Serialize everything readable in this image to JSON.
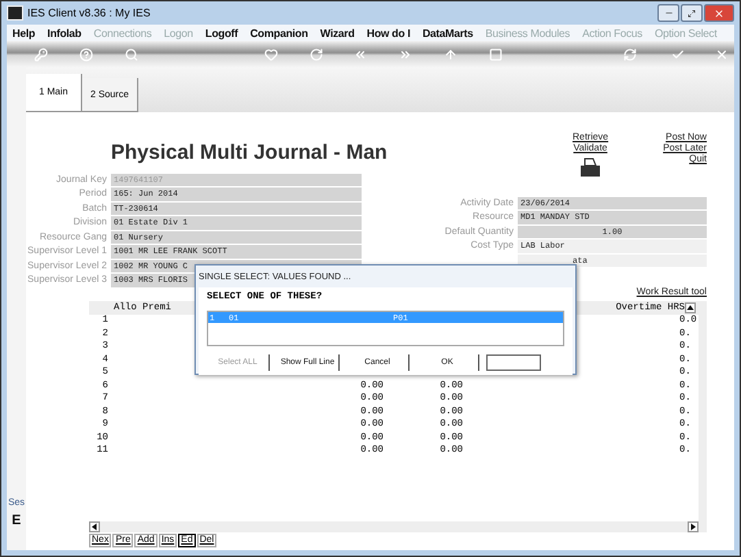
{
  "window": {
    "title": "IES Client v8.36 : My IES"
  },
  "menu": [
    {
      "label": "Help",
      "disabled": false
    },
    {
      "label": "Infolab",
      "disabled": false
    },
    {
      "label": "Connections",
      "disabled": true
    },
    {
      "label": "Logon",
      "disabled": true
    },
    {
      "label": "Logoff",
      "disabled": false
    },
    {
      "label": "Companion",
      "disabled": false
    },
    {
      "label": "Wizard",
      "disabled": false
    },
    {
      "label": "How do I",
      "disabled": false
    },
    {
      "label": "DataMarts",
      "disabled": false
    },
    {
      "label": "Business Modules",
      "disabled": true
    },
    {
      "label": "Action Focus",
      "disabled": true
    },
    {
      "label": "Option Select",
      "disabled": true
    }
  ],
  "tabs": [
    {
      "label": "1 Main",
      "selected": true
    },
    {
      "label": "2 Source",
      "selected": false
    }
  ],
  "form": {
    "title": "Physical Multi Journal - Man",
    "left_fields": [
      {
        "label": "Journal Key",
        "value": "1497641107",
        "disabled": true
      },
      {
        "label": "Period",
        "value": "165: Jun 2014",
        "disabled": false
      },
      {
        "label": "Batch",
        "value": "TT-230614",
        "disabled": false
      },
      {
        "label": "Division",
        "value": "01 Estate Div 1",
        "disabled": false
      },
      {
        "label": "Resource Gang",
        "value": "01 Nursery",
        "disabled": false
      },
      {
        "label": "Supervisor Level 1",
        "value": "1001 MR LEE FRANK SCOTT",
        "disabled": false
      },
      {
        "label": "Supervisor Level 2",
        "value": "1002 MR YOUNG C",
        "disabled": false
      },
      {
        "label": "Supervisor Level 3",
        "value": "1003 MRS FLORIS",
        "disabled": false
      }
    ],
    "links_left": [
      "Retrieve",
      "Validate"
    ],
    "links_right": [
      "Post Now",
      "Post Later",
      "Quit"
    ],
    "right_fields": [
      {
        "label": "Activity Date",
        "value": "23/06/2014",
        "kind": "text"
      },
      {
        "label": "Resource",
        "value": "MD1 MANDAY STD",
        "kind": "text"
      },
      {
        "label": "Default Quantity",
        "value": "1.00",
        "kind": "number"
      },
      {
        "label": "Cost Type",
        "value": "LAB Labor",
        "kind": "text"
      }
    ],
    "covered_field_value": "ata",
    "work_result_link": "Work Result tool"
  },
  "grid": {
    "columns": [
      "Allo Premi",
      "Overtime HRS"
    ],
    "rows": [
      {
        "number": "1",
        "overtime": "0.0"
      },
      {
        "number": "2",
        "overtime": "0."
      },
      {
        "number": "3",
        "overtime": "0."
      },
      {
        "number": "4",
        "overtime": "0."
      },
      {
        "number": "5",
        "overtime": "0."
      },
      {
        "number": "6",
        "col_2": "0.00",
        "col_3": "0.00",
        "overtime": "0."
      },
      {
        "number": "7",
        "col_2": "0.00",
        "col_3": "0.00",
        "overtime": "0."
      },
      {
        "number": "8",
        "col_2": "0.00",
        "col_3": "0.00",
        "overtime": "0."
      },
      {
        "number": "9",
        "col_2": "0.00",
        "col_3": "0.00",
        "overtime": "0."
      },
      {
        "number": "10",
        "col_2": "0.00",
        "col_3": "0.00",
        "overtime": "0."
      },
      {
        "number": "11",
        "col_2": "0.00",
        "col_3": "0.00",
        "overtime": "0."
      }
    ],
    "nav_buttons": [
      {
        "label": "Nex",
        "selected": false
      },
      {
        "label": "Pre",
        "selected": false
      },
      {
        "label": "Add",
        "selected": false
      },
      {
        "label": "Ins",
        "selected": false
      },
      {
        "label": "Ed",
        "selected": true
      },
      {
        "label": "Del",
        "selected": false
      }
    ]
  },
  "side_labels": [
    "Ses",
    "E"
  ],
  "dialog": {
    "title": "SINGLE SELECT: VALUES FOUND ...",
    "prompt": "SELECT ONE OF THESE?",
    "items": [
      {
        "number": "1",
        "code": "01",
        "value": "P01",
        "selected": true
      }
    ],
    "buttons": [
      {
        "label": "Select ALL",
        "disabled": true
      },
      {
        "label": "Show Full Line",
        "disabled": false
      },
      {
        "label": "Cancel",
        "disabled": false
      },
      {
        "label": "OK",
        "disabled": false
      }
    ]
  }
}
